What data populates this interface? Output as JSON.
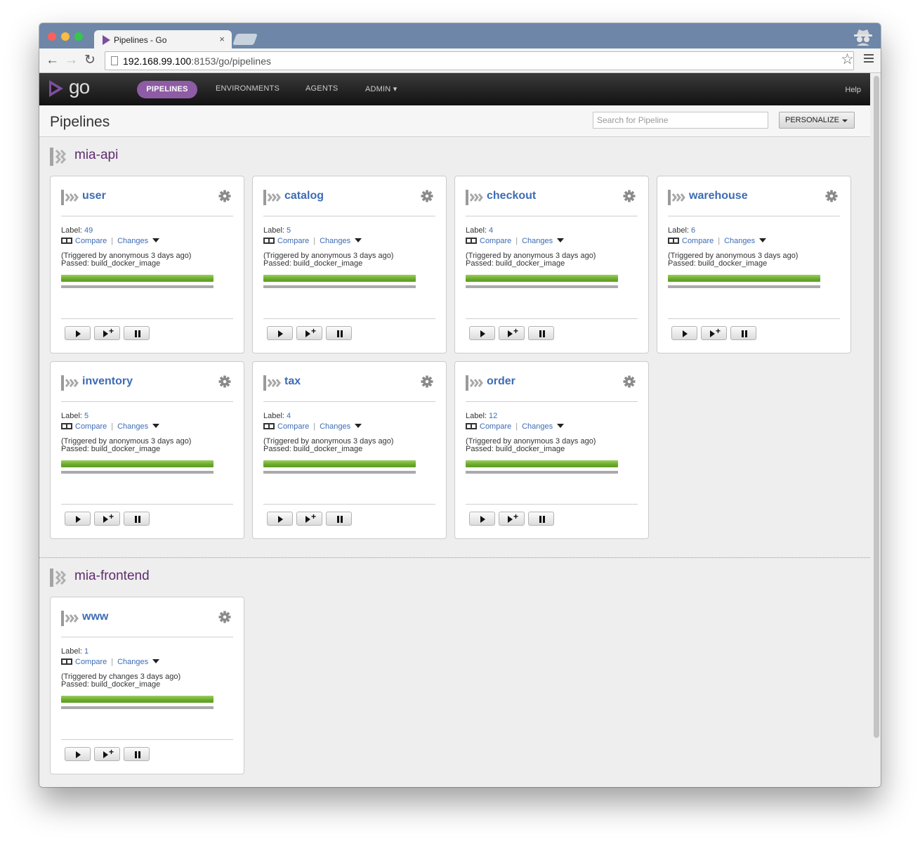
{
  "browser": {
    "tab_title": "Pipelines - Go",
    "tab_close": "×",
    "url_host": "192.168.99.100",
    "url_rest": ":8153/go/pipelines"
  },
  "app": {
    "logo": "go",
    "nav": {
      "pipelines": "PIPELINES",
      "environments": "ENVIRONMENTS",
      "agents": "AGENTS",
      "admin": "ADMIN ▾",
      "help": "Help"
    },
    "page_title": "Pipelines",
    "search_placeholder": "Search for Pipeline",
    "personalize": "PERSONALIZE"
  },
  "labels": {
    "label": "Label: ",
    "compare": "Compare",
    "changes": "Changes"
  },
  "groups": [
    {
      "name": "mia-api",
      "pipelines": [
        {
          "name": "user",
          "label": "49",
          "triggered": "(Triggered by anonymous 3 days ago)",
          "passed": "Passed: build_docker_image"
        },
        {
          "name": "catalog",
          "label": "5",
          "triggered": "(Triggered by anonymous 3 days ago)",
          "passed": "Passed: build_docker_image"
        },
        {
          "name": "checkout",
          "label": "4",
          "triggered": "(Triggered by anonymous 3 days ago)",
          "passed": "Passed: build_docker_image"
        },
        {
          "name": "warehouse",
          "label": "6",
          "triggered": "(Triggered by anonymous 3 days ago)",
          "passed": "Passed: build_docker_image"
        },
        {
          "name": "inventory",
          "label": "5",
          "triggered": "(Triggered by anonymous 3 days ago)",
          "passed": "Passed: build_docker_image"
        },
        {
          "name": "tax",
          "label": "4",
          "triggered": "(Triggered by anonymous 3 days ago)",
          "passed": "Passed: build_docker_image"
        },
        {
          "name": "order",
          "label": "12",
          "triggered": "(Triggered by anonymous 3 days ago)",
          "passed": "Passed: build_docker_image"
        }
      ]
    },
    {
      "name": "mia-frontend",
      "pipelines": [
        {
          "name": "www",
          "label": "1",
          "triggered": "(Triggered by changes 3 days ago)",
          "passed": "Passed: build_docker_image"
        }
      ]
    }
  ],
  "colors": {
    "accent": "#8e5ca5",
    "link": "#3d6cb5",
    "group": "#5f2c6f",
    "passed": "#69a92a"
  }
}
